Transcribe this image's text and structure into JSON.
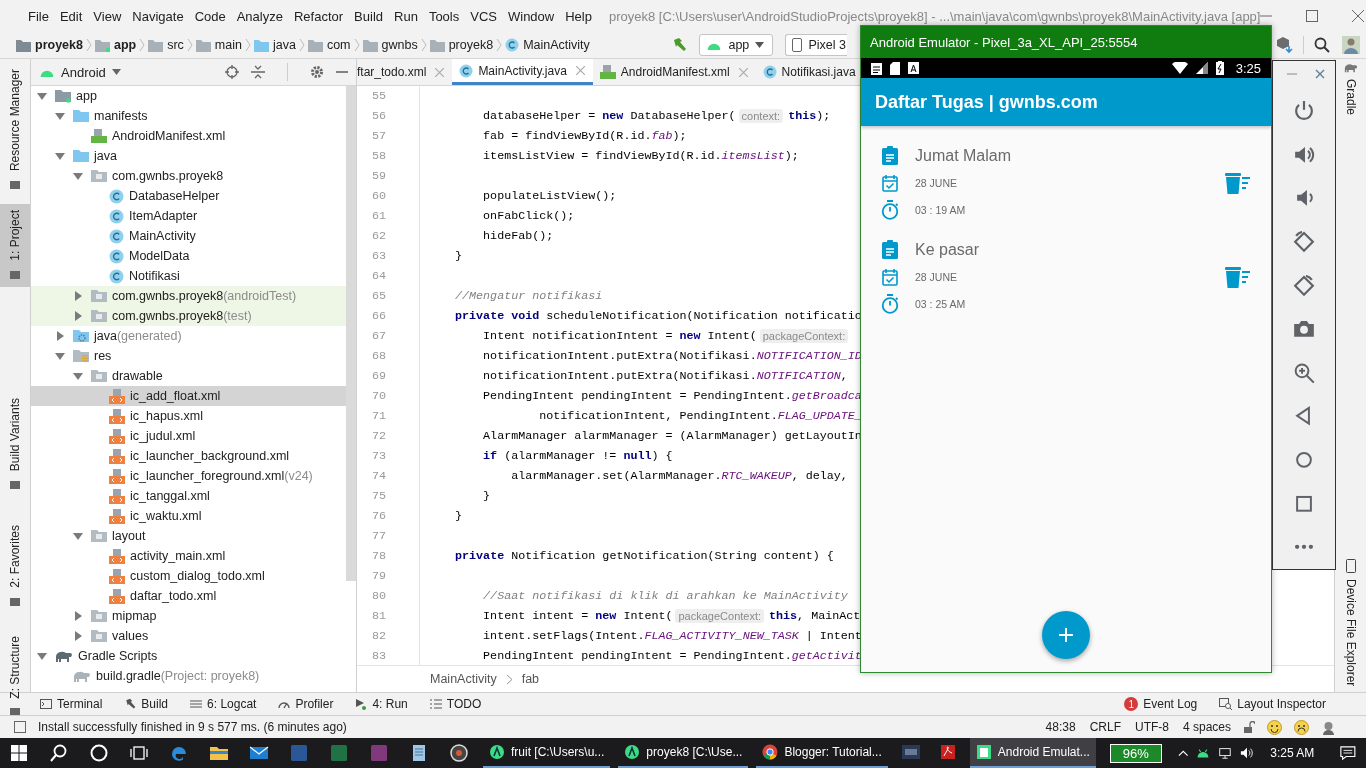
{
  "window": {
    "title": "proyek8 [C:\\Users\\user\\AndroidStudioProjects\\proyek8] - ...\\main\\java\\com\\gwnbs\\proyek8\\MainActivity.java [app]"
  },
  "menu": [
    "File",
    "Edit",
    "View",
    "Navigate",
    "Code",
    "Analyze",
    "Refactor",
    "Build",
    "Run",
    "Tools",
    "VCS",
    "Window",
    "Help"
  ],
  "breadcrumbs": [
    {
      "label": "proyek8",
      "kind": "project"
    },
    {
      "label": "app",
      "kind": "module"
    },
    {
      "label": "src",
      "kind": "folder"
    },
    {
      "label": "main",
      "kind": "folder"
    },
    {
      "label": "java",
      "kind": "source"
    },
    {
      "label": "com",
      "kind": "package"
    },
    {
      "label": "gwnbs",
      "kind": "package"
    },
    {
      "label": "proyek8",
      "kind": "package"
    },
    {
      "label": "MainActivity",
      "kind": "class"
    }
  ],
  "run_config": {
    "module": "app",
    "device": "Pixel 3"
  },
  "left_tool_tabs": [
    {
      "label": "Resource Manager",
      "selected": false
    },
    {
      "label": "1: Project",
      "selected": true
    },
    {
      "label": "Build Variants",
      "selected": false
    },
    {
      "label": "2: Favorites",
      "selected": false
    },
    {
      "label": "Z: Structure",
      "selected": false
    }
  ],
  "project_panel": {
    "view": "Android"
  },
  "project_tree": [
    {
      "label": "app",
      "kind": "module",
      "expanded": true,
      "selected": false,
      "children": [
        {
          "label": "manifests",
          "kind": "folder-blue",
          "expanded": true,
          "selected": false,
          "children": [
            {
              "label": "AndroidManifest.xml",
              "kind": "manifest",
              "selected": false
            }
          ]
        },
        {
          "label": "java",
          "kind": "folder-blue",
          "expanded": true,
          "selected": false,
          "children": [
            {
              "label": "com.gwnbs.proyek8",
              "kind": "package",
              "expanded": true,
              "selected": false,
              "children": [
                {
                  "label": "DatabaseHelper",
                  "kind": "class",
                  "selected": false
                },
                {
                  "label": "ItemAdapter",
                  "kind": "class",
                  "selected": false
                },
                {
                  "label": "MainActivity",
                  "kind": "class",
                  "selected": false
                },
                {
                  "label": "ModelData",
                  "kind": "class",
                  "selected": false
                },
                {
                  "label": "Notifikasi",
                  "kind": "class",
                  "selected": false
                }
              ]
            },
            {
              "label": "com.gwnbs.proyek8",
              "suffix": "(androidTest)",
              "kind": "test-package",
              "expanded": false,
              "selected": false
            },
            {
              "label": "com.gwnbs.proyek8",
              "suffix": "(test)",
              "kind": "test-package",
              "expanded": false,
              "selected": false
            }
          ]
        },
        {
          "label": "java",
          "suffix": "(generated)",
          "kind": "generated",
          "expanded": false,
          "selected": false
        },
        {
          "label": "res",
          "kind": "res",
          "expanded": true,
          "selected": false,
          "children": [
            {
              "label": "drawable",
              "kind": "package",
              "expanded": true,
              "selected": false,
              "children": [
                {
                  "label": "ic_add_float.xml",
                  "kind": "xml",
                  "selected": true
                },
                {
                  "label": "ic_hapus.xml",
                  "kind": "xml",
                  "selected": false
                },
                {
                  "label": "ic_judul.xml",
                  "kind": "xml",
                  "selected": false
                },
                {
                  "label": "ic_launcher_background.xml",
                  "kind": "xml",
                  "selected": false
                },
                {
                  "label": "ic_launcher_foreground.xml",
                  "suffix": "(v24)",
                  "kind": "xml",
                  "selected": false
                },
                {
                  "label": "ic_tanggal.xml",
                  "kind": "xml",
                  "selected": false
                },
                {
                  "label": "ic_waktu.xml",
                  "kind": "xml",
                  "selected": false
                }
              ]
            },
            {
              "label": "layout",
              "kind": "package",
              "expanded": true,
              "selected": false,
              "children": [
                {
                  "label": "activity_main.xml",
                  "kind": "xml",
                  "selected": false
                },
                {
                  "label": "custom_dialog_todo.xml",
                  "kind": "xml",
                  "selected": false
                },
                {
                  "label": "daftar_todo.xml",
                  "kind": "xml",
                  "selected": false
                }
              ]
            },
            {
              "label": "mipmap",
              "kind": "package",
              "expanded": false,
              "selected": false
            },
            {
              "label": "values",
              "kind": "package",
              "expanded": false,
              "selected": false
            }
          ]
        }
      ]
    },
    {
      "label": "Gradle Scripts",
      "kind": "gradle",
      "expanded": true,
      "selected": false,
      "children": [
        {
          "label": "build.gradle",
          "suffix": "(Project: proyek8)",
          "kind": "gradle-file",
          "selected": false
        }
      ]
    }
  ],
  "editor_tabs": [
    {
      "label": "ftar_todo.xml",
      "closable": true,
      "selected": false
    },
    {
      "label": "MainActivity.java",
      "kind": "class",
      "closable": true,
      "selected": true
    },
    {
      "label": "AndroidManifest.xml",
      "kind": "manifest",
      "closable": true,
      "selected": false
    },
    {
      "label": "Notifikasi.java",
      "kind": "class",
      "closable": false,
      "selected": false
    }
  ],
  "code_lines": [
    {
      "number": "55"
    },
    {
      "number": "56",
      "parts": [
        {
          "kind": "code",
          "text": "        databaseHelper = **new** DatabaseHelper("
        },
        {
          "kind": "hint",
          "text": "context:"
        },
        {
          "kind": "code",
          "text": "**this**);"
        }
      ]
    },
    {
      "number": "57",
      "parts": [
        {
          "kind": "code",
          "text": "        fab = findViewById(R.id.*fab*);"
        }
      ]
    },
    {
      "number": "58",
      "parts": [
        {
          "kind": "code",
          "text": "        itemsListView = findViewById(R.id.*itemsList*);"
        }
      ]
    },
    {
      "number": "59"
    },
    {
      "number": "60",
      "parts": [
        {
          "kind": "code",
          "text": "        populateListView();"
        }
      ]
    },
    {
      "number": "61",
      "parts": [
        {
          "kind": "code",
          "text": "        onFabClick();"
        }
      ]
    },
    {
      "number": "62",
      "parts": [
        {
          "kind": "code",
          "text": "        hideFab();"
        }
      ]
    },
    {
      "number": "63",
      "parts": [
        {
          "kind": "code",
          "text": "    }"
        }
      ]
    },
    {
      "number": "64"
    },
    {
      "number": "65",
      "parts": [
        {
          "kind": "comment",
          "text": "    //Mengatur notifikasi"
        }
      ]
    },
    {
      "number": "66",
      "parts": [
        {
          "kind": "code",
          "text": "    **private void** scheduleNotification(Notification notificatio"
        }
      ]
    },
    {
      "number": "67",
      "parts": [
        {
          "kind": "code",
          "text": "        Intent notificationIntent = **new** Intent("
        },
        {
          "kind": "hint",
          "text": "packageContext:"
        }
      ]
    },
    {
      "number": "68",
      "parts": [
        {
          "kind": "code",
          "text": "        notificationIntent.putExtra(Notifikasi.*NOTIFICATION_ID*"
        }
      ]
    },
    {
      "number": "69",
      "parts": [
        {
          "kind": "code",
          "text": "        notificationIntent.putExtra(Notifikasi.*NOTIFICATION*,"
        }
      ]
    },
    {
      "number": "70",
      "parts": [
        {
          "kind": "code",
          "text": "        PendingIntent pendingIntent = PendingIntent.*getBroadca*"
        }
      ]
    },
    {
      "number": "71",
      "parts": [
        {
          "kind": "code",
          "text": "                notificationIntent, PendingIntent.*FLAG_UPDATE_*"
        }
      ]
    },
    {
      "number": "72",
      "parts": [
        {
          "kind": "code",
          "text": "        AlarmManager alarmManager = (AlarmManager) getLayoutIn"
        }
      ]
    },
    {
      "number": "73",
      "parts": [
        {
          "kind": "code",
          "text": "        **if** (alarmManager != **null**) {"
        }
      ]
    },
    {
      "number": "74",
      "parts": [
        {
          "kind": "code",
          "text": "            alarmManager.set(AlarmManager.*RTC_WAKEUP*, delay,"
        }
      ]
    },
    {
      "number": "75",
      "parts": [
        {
          "kind": "code",
          "text": "        }"
        }
      ]
    },
    {
      "number": "76",
      "parts": [
        {
          "kind": "code",
          "text": "    }"
        }
      ]
    },
    {
      "number": "77"
    },
    {
      "number": "78",
      "parts": [
        {
          "kind": "code",
          "text": "    **private** Notification getNotification(String content) {"
        }
      ]
    },
    {
      "number": "79"
    },
    {
      "number": "80",
      "parts": [
        {
          "kind": "comment",
          "text": "        //Saat notifikasi di klik di arahkan ke MainActivity"
        }
      ]
    },
    {
      "number": "81",
      "parts": [
        {
          "kind": "code",
          "text": "        Intent intent = **new** Intent("
        },
        {
          "kind": "hint",
          "text": "packageContext:"
        },
        {
          "kind": "code",
          "text": "**this**, MainAct"
        }
      ]
    },
    {
      "number": "82",
      "parts": [
        {
          "kind": "code",
          "text": "        intent.setFlags(Intent.*FLAG_ACTIVITY_NEW_TASK* | Intent"
        }
      ]
    },
    {
      "number": "83",
      "parts": [
        {
          "kind": "code",
          "text": "        PendingIntent pendingIntent = PendingIntent.*getActivit*"
        }
      ]
    }
  ],
  "editor_breadcrumb": [
    "MainActivity",
    "fab"
  ],
  "right_tool_tabs": [
    {
      "label": "Gradle",
      "kind": "gradle"
    },
    {
      "label": "Device File Explorer",
      "kind": "device"
    }
  ],
  "bottom_tool_tabs": [
    {
      "label": "Terminal",
      "kind": "terminal"
    },
    {
      "label": "Build",
      "kind": "build"
    },
    {
      "label": "6: Logcat",
      "kind": "logcat"
    },
    {
      "label": "Profiler",
      "kind": "profiler"
    },
    {
      "label": "4: Run",
      "kind": "run"
    },
    {
      "label": "TODO",
      "kind": "todo"
    }
  ],
  "event_log": {
    "label": "Event Log",
    "count": "1"
  },
  "layout_inspector": "Layout Inspector",
  "status_bar": {
    "message": "Install successfully finished in 9 s 577 ms. (6 minutes ago)",
    "position": "48:38",
    "line_separator": "CRLF",
    "encoding": "UTF-8",
    "indent": "4 spaces"
  },
  "emulator": {
    "title": "Android Emulator - Pixel_3a_XL_API_25:5554",
    "clock": "3:25",
    "app_title": "Daftar Tugas | gwnbs.com",
    "tasks": [
      {
        "title": "Jumat Malam",
        "date": "28 JUNE",
        "time": "03 : 19 AM"
      },
      {
        "title": "Ke pasar",
        "date": "28 JUNE",
        "time": "03 : 25 AM"
      }
    ]
  },
  "taskbar": {
    "windows": [
      {
        "label": "fruit [C:\\Users\\u...",
        "kind": "studio",
        "selected": false
      },
      {
        "label": "proyek8 [C:\\Use...",
        "kind": "studio",
        "selected": false
      },
      {
        "label": "Blogger: Tutorial...",
        "kind": "chrome",
        "selected": false
      },
      {
        "kind": "rti",
        "selected": false
      },
      {
        "kind": "pdf",
        "selected": false
      },
      {
        "label": "Android Emulat...",
        "kind": "emulator",
        "selected": true
      }
    ],
    "battery": "96%",
    "clock": "3:25 AM"
  }
}
